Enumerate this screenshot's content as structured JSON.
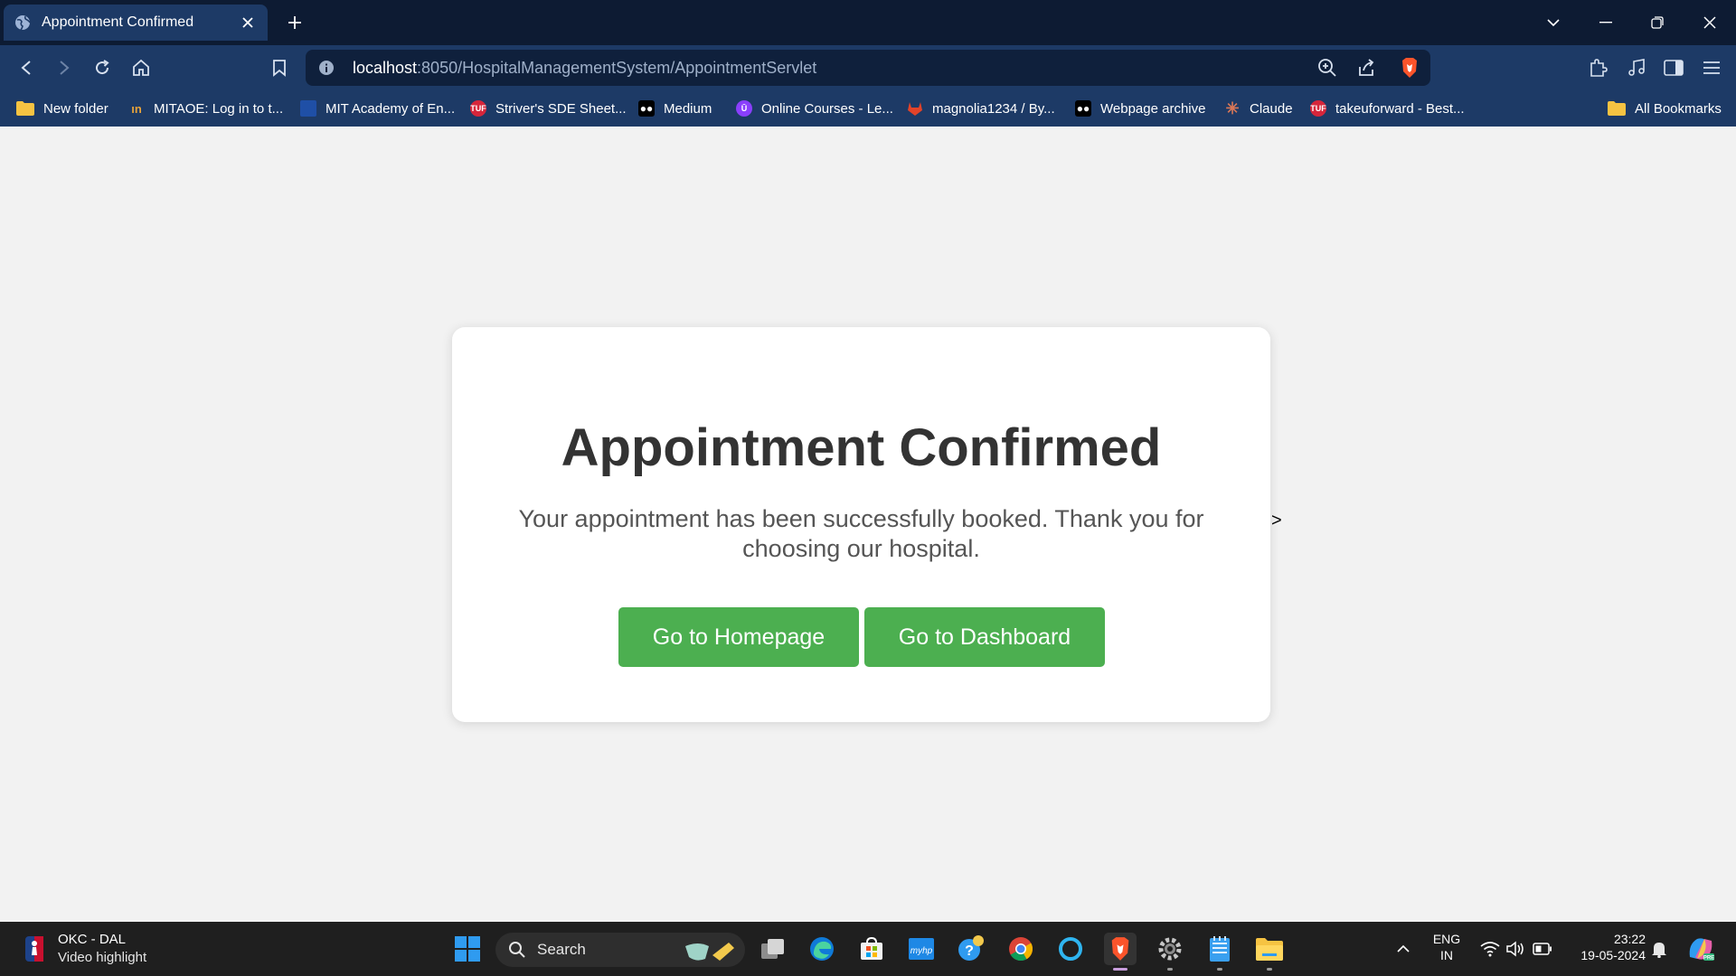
{
  "tab": {
    "title": "Appointment Confirmed"
  },
  "address": {
    "host": "localhost",
    "rest": ":8050/HospitalManagementSystem/AppointmentServlet"
  },
  "bookmarks": [
    {
      "label": "New folder",
      "icon": "folder-icon"
    },
    {
      "label": "MITAOE: Log in to t...",
      "icon": "mitaoe-icon",
      "color": "#e8a33a"
    },
    {
      "label": "MIT Academy of En...",
      "icon": "mit-icon",
      "color": "#1f4fa6"
    },
    {
      "label": "Striver's SDE Sheet...",
      "icon": "tuf-icon",
      "color": "#d6263b"
    },
    {
      "label": "Medium",
      "icon": "medium-icon",
      "color": "#000000"
    },
    {
      "label": "Online Courses - Le...",
      "icon": "udemy-icon",
      "color": "#8a3ffc"
    },
    {
      "label": "magnolia1234 / By...",
      "icon": "gitlab-icon",
      "color": "#e24329"
    },
    {
      "label": "Webpage archive",
      "icon": "archive-icon",
      "color": "#000000"
    },
    {
      "label": "Claude",
      "icon": "claude-icon",
      "color": "#d97757"
    },
    {
      "label": "takeuforward - Best...",
      "icon": "tuf-icon",
      "color": "#d6263b"
    }
  ],
  "all_bookmarks": "All Bookmarks",
  "page": {
    "heading": "Appointment Confirmed",
    "message": "Your appointment has been successfully booked. Thank you for choosing our hospital.",
    "home_button": "Go to Homepage",
    "dashboard_button": "Go to Dashboard",
    "stray_text": ">"
  },
  "taskbar": {
    "news_title": "OKC - DAL",
    "news_sub": "Video highlight",
    "search_label": "Search",
    "lang_top": "ENG",
    "lang_bottom": "IN",
    "time": "23:22",
    "date": "19-05-2024"
  },
  "colors": {
    "button_green": "#4caf50",
    "toolbar_blue": "#1d3a66",
    "titlebar_navy": "#0d1b33"
  }
}
